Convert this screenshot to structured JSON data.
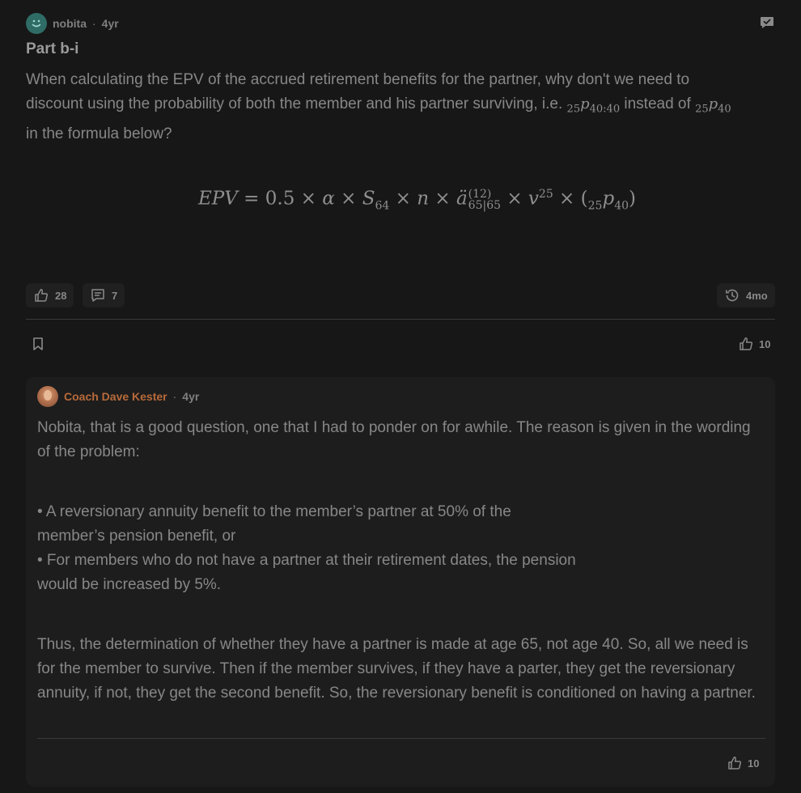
{
  "post": {
    "author": "nobita",
    "separator": "·",
    "age": "4yr",
    "title": "Part b-i",
    "body_line1": "When calculating the EPV of the accrued retirement benefits for the partner, why don't we need to",
    "body_line2_a": "discount using the probability of both the member and his partner surviving, i.e.",
    "body_line2_b": "instead of",
    "body_line3": "in the formula below?",
    "math_joint_pre": "25",
    "math_joint_p": "p",
    "math_joint_sub": "40:40",
    "math_single_pre": "25",
    "math_single_p": "p",
    "math_single_sub": "40",
    "formula": {
      "lhs": "EPV",
      "eq": " = 0.5 × ",
      "alpha": "α",
      "times1": " × ",
      "S": "S",
      "S_sub": "64",
      "times2": " × ",
      "n": "n",
      "times3": " × ",
      "a": "ä",
      "a_sup": "(12)",
      "a_sub": "65|65",
      "times4": " × ",
      "v": "v",
      "v_sup": "25",
      "times5": " × (",
      "p_pre": "25",
      "p": "p",
      "p_sub": "40",
      "close": ")"
    },
    "likes": "28",
    "comments": "7",
    "edited": "4mo"
  },
  "thread": {
    "likes": "10"
  },
  "reply": {
    "author": "Coach Dave Kester",
    "separator": "·",
    "age": "4yr",
    "para1": "Nobita, that is a good question, one that I had to ponder on for awhile. The reason is given in the wording of the problem:",
    "bullet1_a": "• A reversionary annuity benefit to the member’s partner at 50% of the",
    "bullet1_b": "member’s pension benefit, or",
    "bullet2_a": "• For members who do not have a partner at their retirement dates, the pension",
    "bullet2_b": "would be increased by 5%.",
    "para3": "Thus, the determination of whether they have a partner is made at age 65, not age 40. So, all we need is for the member to survive. Then if the member survives, if they have a parter, they get the reversionary annuity, if not, they get the second benefit. So, the reversionary benefit is conditioned on having a partner.",
    "likes": "10"
  },
  "colors": {
    "background": "#171717",
    "reply_card": "#1d1d1d",
    "coach_name": "#b86a3a",
    "avatar_teal": "#2f6c66"
  },
  "icons": [
    "smile-avatar-icon",
    "chat-check-icon",
    "thumbs-up-icon",
    "comment-icon",
    "history-icon",
    "bookmark-icon"
  ]
}
